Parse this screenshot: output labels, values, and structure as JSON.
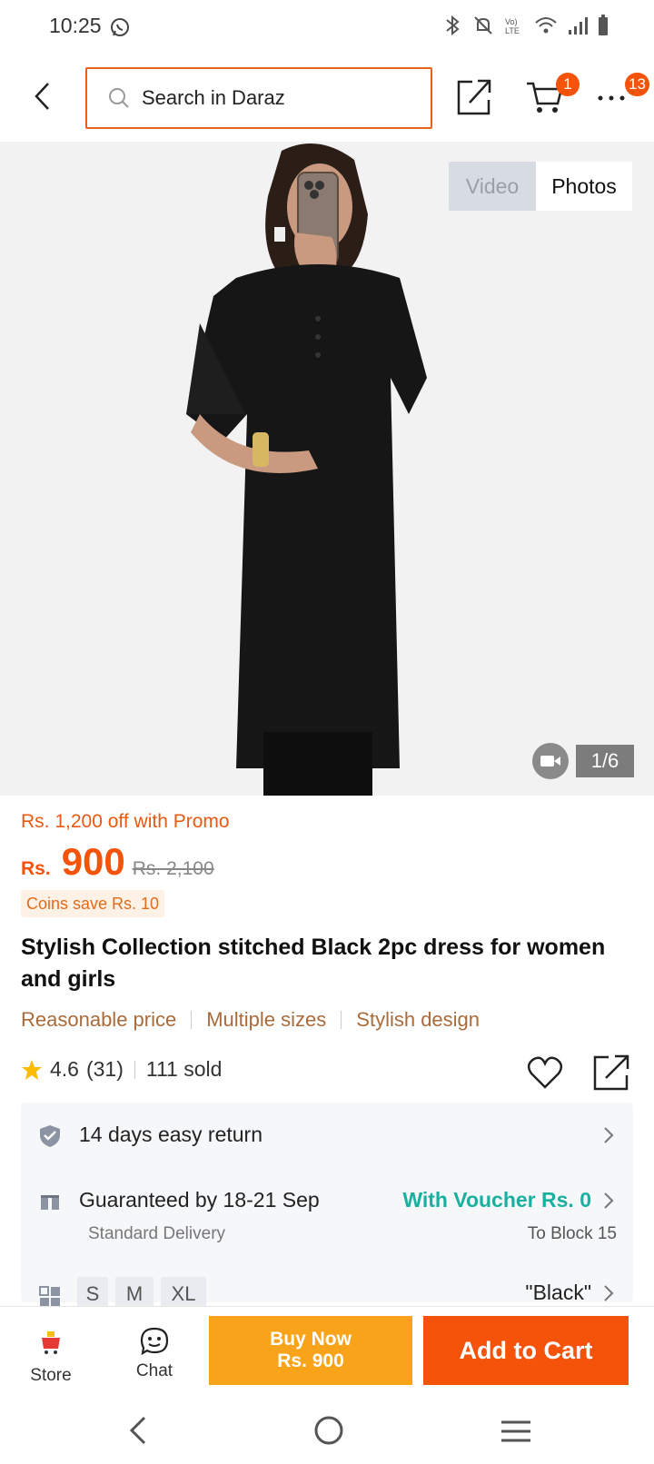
{
  "status_bar": {
    "time": "10:25"
  },
  "header": {
    "search_placeholder": "Search in Daraz",
    "cart_count": "1",
    "more_count": "13"
  },
  "gallery": {
    "video_label": "Video",
    "photos_label": "Photos",
    "counter": "1/6"
  },
  "price": {
    "promo": "Rs. 1,200 off with Promo",
    "currency": "Rs.",
    "current": "900",
    "original": "Rs. 2,100",
    "coins": "Coins save Rs. 10"
  },
  "product": {
    "title": "Stylish Collection stitched Black 2pc dress for women and girls",
    "tags": [
      "Reasonable price",
      "Multiple sizes",
      "Stylish design"
    ],
    "rating": "4.6",
    "reviews": "(31)",
    "sold": "111 sold"
  },
  "info": {
    "return": "14 days easy return",
    "delivery": "Guaranteed by 18-21 Sep",
    "voucher": "With Voucher Rs. 0",
    "delivery_type": "Standard Delivery",
    "location": "To Block 15",
    "sizes": [
      "S",
      "M",
      "XL"
    ],
    "color": "\"Black\""
  },
  "actions": {
    "store": "Store",
    "chat": "Chat",
    "buy_now_line1": "Buy Now",
    "buy_now_line2": "Rs. 900",
    "add_to_cart": "Add to Cart"
  },
  "colors": {
    "accent": "#f5520a",
    "buy_now": "#f9a31a",
    "voucher": "#1ab0a0"
  }
}
